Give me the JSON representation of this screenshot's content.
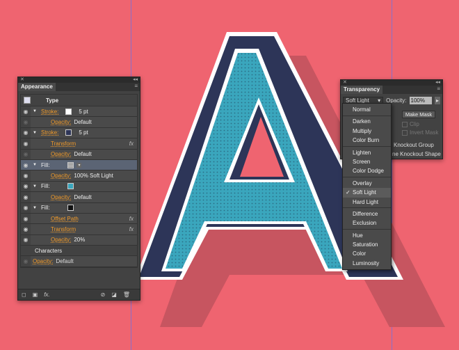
{
  "colors": {
    "background": "#ef6470",
    "shadow": "#c75560",
    "navy": "#2d3558",
    "teal": "#3aa6bd",
    "stroke": "#ffffff"
  },
  "appearance": {
    "tab": "Appearance",
    "header": "Type",
    "rows": [
      {
        "type": "stroke",
        "label": "Stroke:",
        "value": "5 pt",
        "swatch": "#ffffff",
        "eye": true
      },
      {
        "type": "sub",
        "label": "Opacity:",
        "value": "Default",
        "eye": false
      },
      {
        "type": "stroke",
        "label": "Stroke:",
        "value": "5 pt",
        "swatch": "#2d3558",
        "eye": true
      },
      {
        "type": "effect",
        "label": "Transform",
        "eye": true
      },
      {
        "type": "sub",
        "label": "Opacity:",
        "value": "Default",
        "eye": false
      },
      {
        "type": "fill",
        "label": "Fill:",
        "swatch": "pattern",
        "eye": true,
        "selected": true
      },
      {
        "type": "sub",
        "label": "Opacity:",
        "value": "100% Soft Light",
        "eye": true
      },
      {
        "type": "fill",
        "label": "Fill:",
        "swatch": "#3aa6bd",
        "eye": true
      },
      {
        "type": "sub",
        "label": "Opacity:",
        "value": "Default",
        "eye": true
      },
      {
        "type": "fill",
        "label": "Fill:",
        "swatch": "#111111",
        "eye": true
      },
      {
        "type": "effect",
        "label": "Offset Path",
        "eye": true
      },
      {
        "type": "effect",
        "label": "Transform",
        "eye": true
      },
      {
        "type": "sub",
        "label": "Opacity:",
        "value": "20%",
        "eye": true
      }
    ],
    "characters": "Characters",
    "char_opacity_label": "Opacity:",
    "char_opacity_value": "Default",
    "fx": "fx",
    "footer_fx": "fx."
  },
  "transparency": {
    "tab": "Transparency",
    "mode": "Soft Light",
    "opacity_label": "Opacity:",
    "opacity_value": "100%",
    "make_mask": "Make Mask",
    "clip": "Clip",
    "invert_mask": "Invert Mask",
    "knockout_group": "Knockout Group",
    "knockout_shape": "ne Knockout Shape"
  },
  "blend_menu": {
    "groups": [
      [
        "Normal"
      ],
      [
        "Darken",
        "Multiply",
        "Color Burn"
      ],
      [
        "Lighten",
        "Screen",
        "Color Dodge"
      ],
      [
        "Overlay",
        "Soft Light",
        "Hard Light"
      ],
      [
        "Difference",
        "Exclusion"
      ],
      [
        "Hue",
        "Saturation",
        "Color",
        "Luminosity"
      ]
    ],
    "selected": "Soft Light"
  }
}
